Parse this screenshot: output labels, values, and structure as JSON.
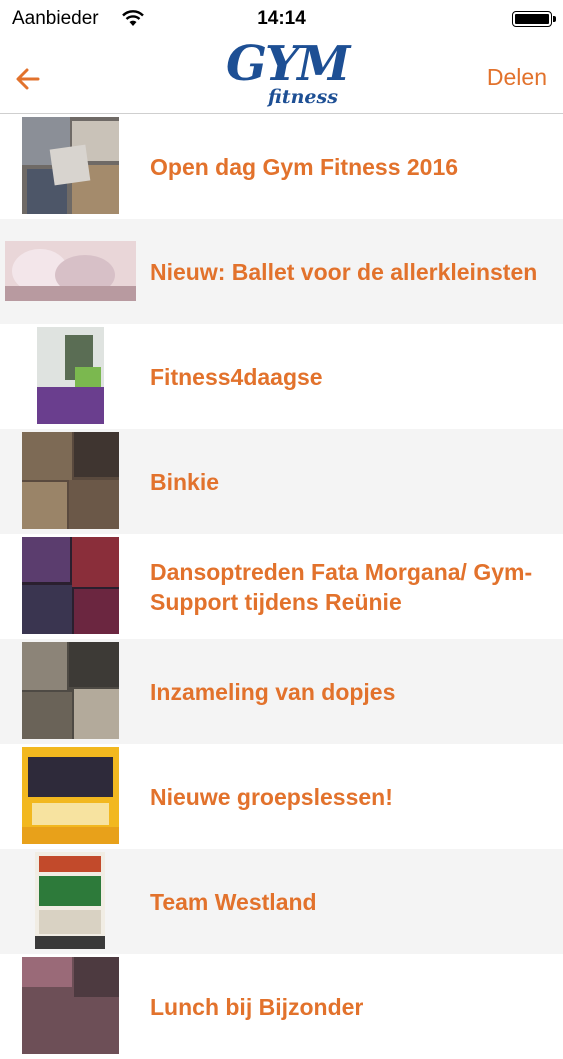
{
  "status_bar": {
    "carrier": "Aanbieder",
    "time": "14:14"
  },
  "nav": {
    "back_icon": "arrow-left-icon",
    "logo_main": "GYM",
    "logo_sub": "fitness",
    "share_label": "Delen"
  },
  "colors": {
    "accent": "#e2722c",
    "logo_blue": "#1d4f94",
    "alt_row": "#f4f4f4"
  },
  "news": [
    {
      "title": "Open dag Gym Fitness 2016"
    },
    {
      "title": "Nieuw: Ballet voor de allerkleinsten"
    },
    {
      "title": "Fitness4daagse"
    },
    {
      "title": "Binkie"
    },
    {
      "title": "Dansoptreden Fata Morgana/ Gym-Support tijdens Reünie"
    },
    {
      "title": "Inzameling van dopjes"
    },
    {
      "title": "Nieuwe groepslessen!"
    },
    {
      "title": "Team Westland"
    },
    {
      "title": "Lunch bij Bijzonder"
    }
  ]
}
